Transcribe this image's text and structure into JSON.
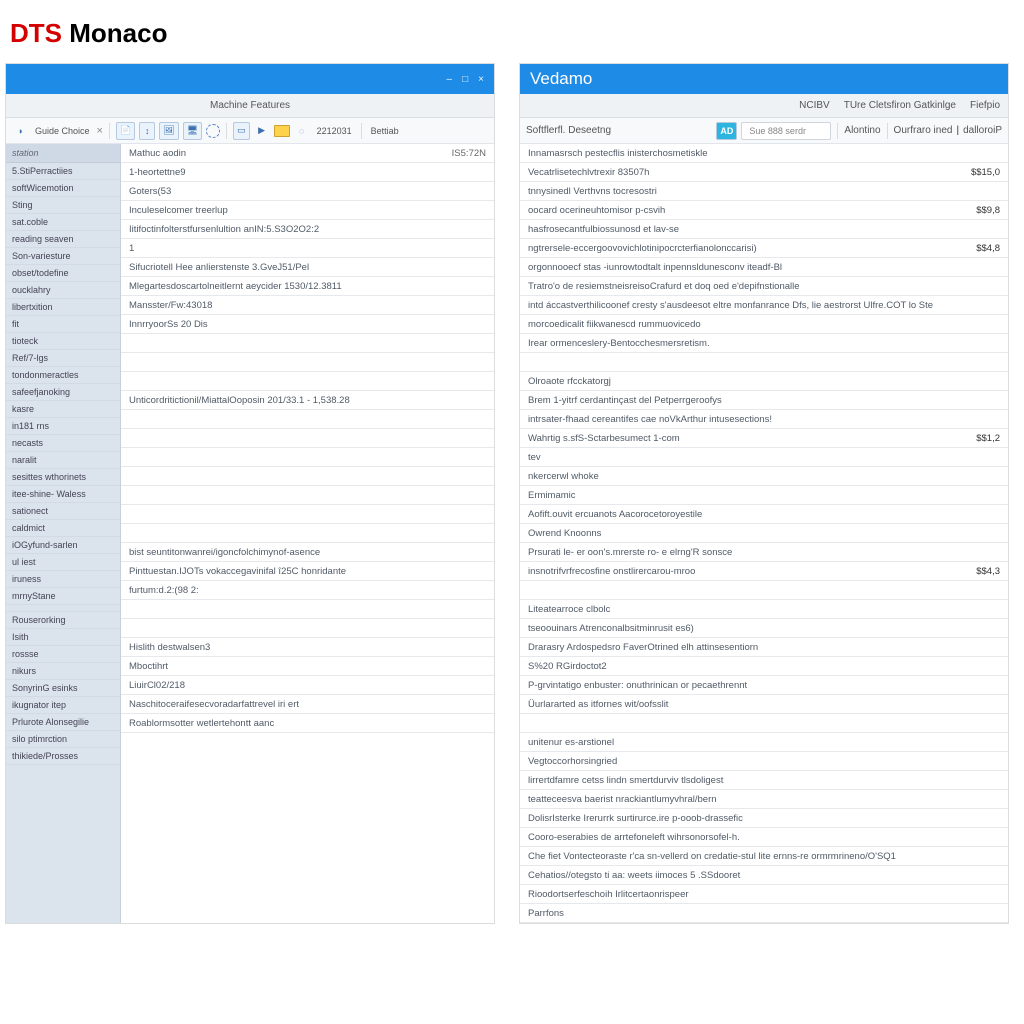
{
  "page": {
    "brand_prefix": "DTS",
    "brand_main": "Monaco"
  },
  "left": {
    "titlebar_label": "",
    "sys_icons": [
      "–",
      "□",
      "×"
    ],
    "subheader": {
      "center": "Machine Features"
    },
    "toolbar": {
      "lead_icon": "◑",
      "chip_label": "Guide Choice",
      "close": "×",
      "icons": [
        "📄",
        "↕",
        "🖼",
        "🖥",
        "🌐"
      ],
      "play": "▶",
      "yellow": "",
      "digits": "2212031",
      "tail": "Bettiab"
    },
    "sidebar_head": "station",
    "sidebar": [
      "5.StiPerractiies",
      "softWicemotion",
      "Sting",
      "sat.coble",
      "reading seaven",
      "Son-variesture",
      "obset/todefine",
      "oucklahry",
      "libertxition",
      "fit",
      "tioteck",
      "Ref/7-lgs",
      "tondonmeractles",
      "safeefjanoking",
      "kasre",
      "in181 rns",
      "necasts",
      "naralit",
      "sesittes wthorinets",
      "itee-shine- Waless",
      "sationect",
      "caldmict",
      "iOGyfund-sarlen",
      "ul iest",
      "iruness",
      "mrnyStane",
      "",
      "Rouserorking",
      "Isith",
      "rossse",
      "nikurs",
      "SonyrinG esinks",
      "ikugnator itep",
      "Prlurote Alonsegilie",
      "silo ptimrction",
      "thikiede/Prosses"
    ],
    "rows": [
      {
        "k": "Mathuc aodin",
        "v": "IS5:72N"
      },
      {
        "k": "1-heortettne9"
      },
      {
        "k": "Goters(53"
      },
      {
        "k": "Inculeselcomer treerlup"
      },
      {
        "k": "Iitifoctinfolterstfursenlultion anIN:5.S3O2O2:2"
      },
      {
        "k": "1"
      },
      {
        "k": "Sifucriotell Hee anlierstenste 3.GveJ51/Pel"
      },
      {
        "k": "Mlegartesdoscartolneitlernt aeycider 1530/12.3811"
      },
      {
        "k": "Mansster/Fw:43018"
      },
      {
        "k": "InnrryoorSs 20 Dis"
      },
      {
        "k": ""
      },
      {
        "k": ""
      },
      {
        "k": ""
      },
      {
        "k": "Unticordritictionil/MiattalOoposin 201/33.1 - 1,538.28"
      },
      {
        "k": ""
      },
      {
        "k": ""
      },
      {
        "k": ""
      },
      {
        "k": ""
      },
      {
        "k": ""
      },
      {
        "k": ""
      },
      {
        "k": ""
      },
      {
        "k": "bist seuntitonwanrei/igoncfolchimynof-asence"
      },
      {
        "k": "Pinttuestan.IJOTs vokaccegavinifal î25C honridante"
      },
      {
        "k": "furtum:d.2:(98 2:"
      },
      {
        "k": ""
      },
      {
        "k": ""
      },
      {
        "k": "Hislith destwalsen3"
      },
      {
        "k": "Mboctihrt"
      },
      {
        "k": "LiuirCl02/218"
      },
      {
        "k": "Naschitoceraifesecvoradarfattrevel iri ert"
      },
      {
        "k": "Roablormsotter wetlertehontt aanc"
      }
    ]
  },
  "right": {
    "titlebar_label": "Vedamo",
    "subheader": {
      "left": "Softflerfl. Deseetng",
      "c1": "NCIBV",
      "c2": "TUre Cletsfiron Gatkinlge",
      "c3": "Fiefpio"
    },
    "toolbar": {
      "badge": "AD",
      "search_placeholder": "Sue 888 serdr",
      "tab1": "Alontino",
      "tab2": "Ourfraro ined",
      "tab3": "dalloroiP"
    },
    "rows": [
      {
        "k": "Innamasrsch pestecflis inisterchosmetiskle"
      },
      {
        "k": "Vecatrlisetechlvtrexir 83507h",
        "v": "$$15,0"
      },
      {
        "k": "tnnysinedl Verthvns tocresostri"
      },
      {
        "k": "oocard ocerineuhtomisor p-csvih",
        "v": "$$9,8"
      },
      {
        "k": "hasfrosecantfulbiossunosd et lav-se"
      },
      {
        "k": "ngtrersele-eccergoovovichlotinipocrcterfianolonccarisi)",
        "v": "$$4,8"
      },
      {
        "k": "orgonnooecf stas -iunrowtodtalt inpennsldunesconv iteadf-Bl"
      },
      {
        "k": "Tratro'o de resiemstneisreisoCrafurd et doq oed e'depifnstionalle"
      },
      {
        "k": "intd áccastverthilicoonef cresty s'ausdeesot eltre monfanrance Dfs, lie aestrorst Ulfre.COT lo Ste"
      },
      {
        "k": "morcoedicalit fiikwanescd rummuovicedo"
      },
      {
        "k": "Irear ormenceslery-Bentocchesmersretism."
      },
      {
        "k": ""
      },
      {
        "k": "Olroaote rfcckatorgj"
      },
      {
        "k": "Brem 1-yitrf cerdantinçast del Petperrgeroofys"
      },
      {
        "k": "intrsater-fhaad cereantifes cae noVkArthur intusesections!"
      },
      {
        "k": "Wahrtig s.sfS-Sctarbesumect 1-com",
        "v": "$$1,2"
      },
      {
        "k": "tev"
      },
      {
        "k": "nkercerwl whoke"
      },
      {
        "k": "Ermimamic"
      },
      {
        "k": "Aofift.ouvit ercuanots Aacorocetoroyestile"
      },
      {
        "k": "Owrend Knoonns"
      },
      {
        "k": "Prsurati le- er oon's.mrerste ro- e elrng'R sonsce"
      },
      {
        "k": "insnotrifvrfrecosfine onstlirercarou-mroo",
        "v": "$$4,3"
      },
      {
        "k": ""
      },
      {
        "k": "Liteatearroce clbolc"
      },
      {
        "k": "tseoouinars Atrenconalbsitminrusit es6)"
      },
      {
        "k": "Drarasry Ardospedsro FaverOtrined elh attinsesentiorn"
      },
      {
        "k": "S%20 RGirdoctot2"
      },
      {
        "k": "P-grvintatigo enbuster: onuthrinican or pecaethrennt"
      },
      {
        "k": "Üurlararted as itfornes wit/oofsslit"
      },
      {
        "k": ""
      },
      {
        "k": "unitenur es-arstionel"
      },
      {
        "k": "Vegtoccorhorsingried"
      },
      {
        "k": "lirrertdfamre cetss lindn smertdurviv tlsdoligest"
      },
      {
        "k": "teatteceesva baerist nrackiantlumyvhral/bern"
      },
      {
        "k": "DolisrIsterke Irerurrk surtirurce.ire p-ooob-drassefic"
      },
      {
        "k": "Cooro-eserabies de arrtefoneleft wihrsonorsofel-h."
      },
      {
        "k": "Che fiet Vontecteoraste r'ca sn-vellerd on credatie-stul lite ernns-re ormrmrineno/O'SQ1"
      },
      {
        "k": "Cehatios//otegsto ti aa: weets iimoces 5 .SSdooret"
      },
      {
        "k": "Rioodortserfeschoih Irlitcertaonrispeer"
      },
      {
        "k": "Parrfons"
      }
    ]
  }
}
